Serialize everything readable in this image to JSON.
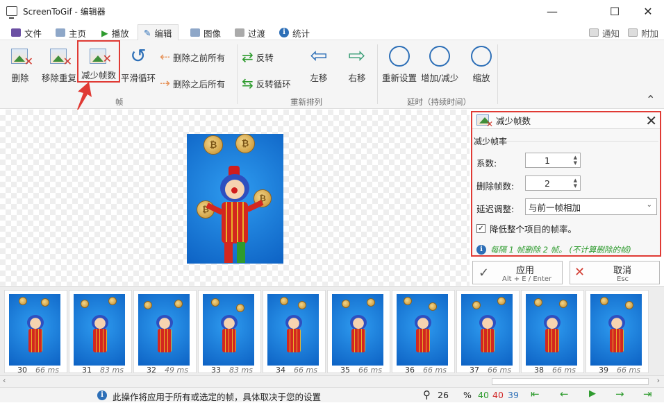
{
  "window": {
    "title": "ScreenToGif - 编辑器",
    "minimize": "—",
    "maximize": "☐",
    "close": "✕"
  },
  "menu": {
    "tabs": [
      {
        "label": "文件",
        "icon": "save-icon"
      },
      {
        "label": "主页",
        "icon": "home-icon"
      },
      {
        "label": "播放",
        "icon": "play-icon"
      },
      {
        "label": "编辑",
        "icon": "edit-icon"
      },
      {
        "label": "图像",
        "icon": "image-icon"
      },
      {
        "label": "过渡",
        "icon": "transition-icon"
      },
      {
        "label": "统计",
        "icon": "info-icon"
      }
    ],
    "active_tab": "编辑",
    "right": [
      {
        "label": "通知",
        "icon": "notification-icon"
      },
      {
        "label": "附加",
        "icon": "extras-icon"
      }
    ]
  },
  "ribbon": {
    "frame_group": {
      "label": "帧",
      "buttons": [
        "删除",
        "移除重复",
        "减少帧数",
        "平滑循环"
      ],
      "small_buttons": [
        "删除之前所有",
        "删除之后所有"
      ]
    },
    "reorder_group": {
      "label": "重新排列",
      "small_buttons": [
        "反转",
        "反转循环"
      ],
      "buttons": [
        "左移",
        "右移"
      ]
    },
    "delay_group": {
      "label": "延时（持续时间）",
      "buttons": [
        "重新设置",
        "增加/减少",
        "缩放"
      ]
    },
    "collapse": "⌃"
  },
  "panel": {
    "title": "减少帧数",
    "section": "减少帧率",
    "factor_label": "系数:",
    "factor_value": "1",
    "remove_label": "删除帧数:",
    "remove_value": "2",
    "delay_label": "延迟调整:",
    "delay_value": "与前一帧相加",
    "checkbox_label": "降低整个项目的帧率。",
    "checkbox_checked": true,
    "info_text": "每隔 1 帧删除 2 帧。 (不计算删除的帧)",
    "info_color": "#2e9b2e"
  },
  "actions": {
    "apply": {
      "label": "应用",
      "shortcut": "Alt + E / Enter"
    },
    "cancel": {
      "label": "取消",
      "shortcut": "Esc"
    }
  },
  "frames": [
    {
      "num": "30",
      "ms": "66 ms"
    },
    {
      "num": "31",
      "ms": "83 ms"
    },
    {
      "num": "32",
      "ms": "49 ms"
    },
    {
      "num": "33",
      "ms": "83 ms"
    },
    {
      "num": "34",
      "ms": "66 ms"
    },
    {
      "num": "35",
      "ms": "66 ms"
    },
    {
      "num": "36",
      "ms": "66 ms"
    },
    {
      "num": "37",
      "ms": "66 ms"
    },
    {
      "num": "38",
      "ms": "66 ms"
    },
    {
      "num": "39",
      "ms": "66 ms"
    }
  ],
  "status": {
    "message": "此操作将应用于所有或选定的帧，具体取决于您的设置",
    "zoom": "26",
    "zoom_unit": "%",
    "count_total": "40",
    "count_selected": "40",
    "count_current": "39",
    "colors": {
      "total": "#2e9b2e",
      "selected": "#d12a2a",
      "current": "#2d6fb7"
    }
  },
  "colors": {
    "accent": "#2d6fb7",
    "highlight": "#e03a34"
  }
}
